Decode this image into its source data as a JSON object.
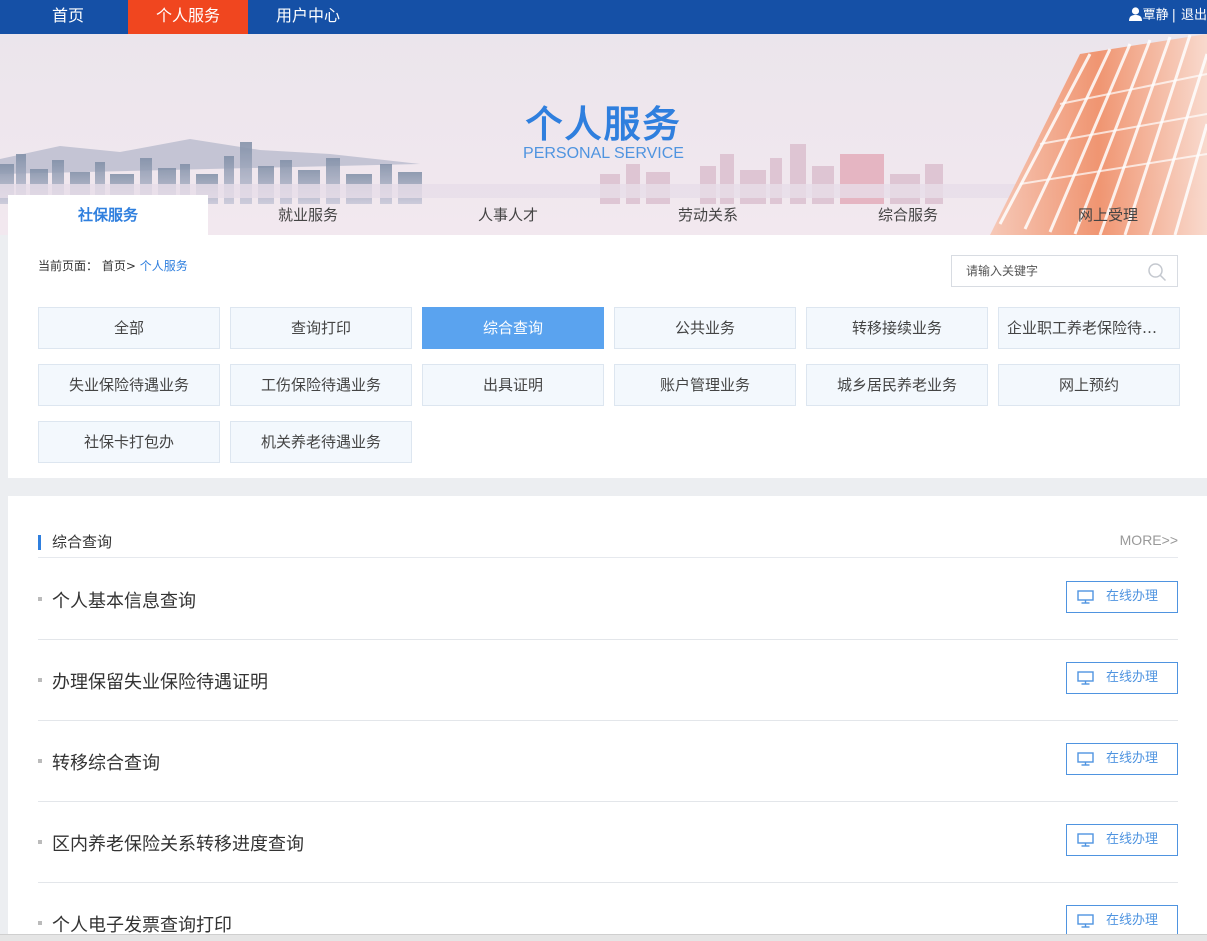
{
  "topnav": {
    "items": [
      {
        "label": "首页",
        "active": false
      },
      {
        "label": "个人服务",
        "active": true
      },
      {
        "label": "用户中心",
        "active": false
      }
    ],
    "user_name": "覃静",
    "separator": "|",
    "logout_label": "退出"
  },
  "banner": {
    "title": "个人服务",
    "subtitle": "PERSONAL SERVICE"
  },
  "category_tabs": [
    {
      "label": "社保服务",
      "active": true
    },
    {
      "label": "就业服务",
      "active": false
    },
    {
      "label": "人事人才",
      "active": false
    },
    {
      "label": "劳动关系",
      "active": false
    },
    {
      "label": "综合服务",
      "active": false
    },
    {
      "label": "网上受理",
      "active": false
    }
  ],
  "breadcrumb": {
    "prefix": "当前页面：",
    "home": "首页>",
    "current": "个人服务"
  },
  "search": {
    "placeholder": "请输入关键字"
  },
  "business_buttons": [
    {
      "label": "全部",
      "active": false
    },
    {
      "label": "查询打印",
      "active": false
    },
    {
      "label": "综合查询",
      "active": true
    },
    {
      "label": "公共业务",
      "active": false
    },
    {
      "label": "转移接续业务",
      "active": false
    },
    {
      "label": "企业职工养老保险待遇业务",
      "active": false
    },
    {
      "label": "失业保险待遇业务",
      "active": false
    },
    {
      "label": "工伤保险待遇业务",
      "active": false
    },
    {
      "label": "出具证明",
      "active": false
    },
    {
      "label": "账户管理业务",
      "active": false
    },
    {
      "label": "城乡居民养老业务",
      "active": false
    },
    {
      "label": "网上预约",
      "active": false
    },
    {
      "label": "社保卡打包办",
      "active": false
    },
    {
      "label": "机关养老待遇业务",
      "active": false
    }
  ],
  "section": {
    "title": "综合查询",
    "more_label": "MORE>>",
    "items": [
      {
        "label": "个人基本信息查询",
        "action": "在线办理"
      },
      {
        "label": "办理保留失业保险待遇证明",
        "action": "在线办理"
      },
      {
        "label": "转移综合查询",
        "action": "在线办理"
      },
      {
        "label": "区内养老保险关系转移进度查询",
        "action": "在线办理"
      },
      {
        "label": "个人电子发票查询打印",
        "action": "在线办理"
      }
    ]
  },
  "colors": {
    "nav_bg": "#1550a6",
    "nav_active": "#f0461f",
    "accent": "#2f7fde",
    "active_button": "#5aa3ef"
  }
}
